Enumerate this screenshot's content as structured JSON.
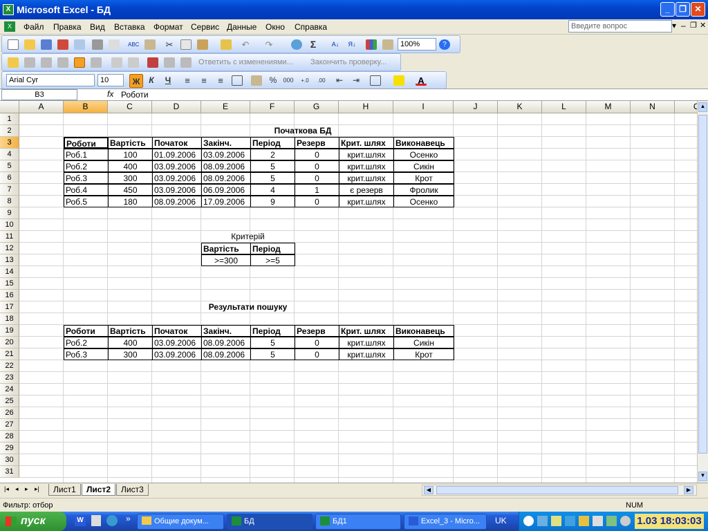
{
  "window": {
    "title": "Microsoft Excel - БД",
    "minimize": "_",
    "restore": "❐",
    "close": "✕"
  },
  "menu": {
    "items": [
      "Файл",
      "Правка",
      "Вид",
      "Вставка",
      "Формат",
      "Сервис",
      "Данные",
      "Окно",
      "Справка"
    ],
    "ask_placeholder": "Введите вопрос"
  },
  "toolbar": {
    "zoom": "100%",
    "review_reply": "Ответить с изменениями...",
    "review_end": "Закончить проверку...",
    "font_name": "Arial Cyr",
    "font_size": "10",
    "bold": "Ж",
    "italic": "К",
    "underline": "Ч",
    "percent": "%",
    "thousands": "000",
    "font_color_glyph": "A"
  },
  "formula_bar": {
    "name_box": "B3",
    "fx": "fx",
    "content": "Роботи"
  },
  "grid": {
    "columns": [
      "A",
      "B",
      "C",
      "D",
      "E",
      "F",
      "G",
      "H",
      "I",
      "J",
      "K",
      "L",
      "M",
      "N",
      "O"
    ],
    "rows": [
      "1",
      "2",
      "3",
      "4",
      "5",
      "6",
      "7",
      "8",
      "9",
      "10",
      "11",
      "12",
      "13",
      "14",
      "15",
      "16",
      "17",
      "18",
      "19",
      "20",
      "21",
      "22",
      "23",
      "24",
      "25",
      "26",
      "27",
      "28",
      "29",
      "30",
      "31"
    ],
    "db_title": "Початкова БД",
    "headers": [
      "Роботи",
      "Вартість",
      "Початок",
      "Закінч.",
      "Період",
      "Резерв",
      "Крит. шлях",
      "Виконавець"
    ],
    "db_rows": [
      [
        "Роб.1",
        "100",
        "01.09.2006",
        "03.09.2006",
        "2",
        "0",
        "крит.шлях",
        "Осенко"
      ],
      [
        "Роб.2",
        "400",
        "03.09.2006",
        "08.09.2006",
        "5",
        "0",
        "крит.шлях",
        "Сикін"
      ],
      [
        "Роб.3",
        "300",
        "03.09.2006",
        "08.09.2006",
        "5",
        "0",
        "крит.шлях",
        "Крот"
      ],
      [
        "Роб.4",
        "450",
        "03.09.2006",
        "06.09.2006",
        "4",
        "1",
        "є резерв",
        "Фролик"
      ],
      [
        "Роб.5",
        "180",
        "08.09.2006",
        "17.09.2006",
        "9",
        "0",
        "крит.шлях",
        "Осенко"
      ]
    ],
    "criteria_title": "Критерій",
    "criteria_headers": [
      "Вартість",
      "Період"
    ],
    "criteria_values": [
      ">=300",
      ">=5"
    ],
    "results_title": "Результати пошуку",
    "result_rows": [
      [
        "Роб.2",
        "400",
        "03.09.2006",
        "08.09.2006",
        "5",
        "0",
        "крит.шлях",
        "Сикін"
      ],
      [
        "Роб.3",
        "300",
        "03.09.2006",
        "08.09.2006",
        "5",
        "0",
        "крит.шлях",
        "Крот"
      ]
    ]
  },
  "sheets": {
    "tabs": [
      "Лист1",
      "Лист2",
      "Лист3"
    ],
    "active": "Лист2"
  },
  "status": {
    "text": "Фильтр: отбор",
    "num": "NUM"
  },
  "taskbar": {
    "start": "пуск",
    "tasks": [
      "Общие докум...",
      "БД",
      "БД1",
      "Excel_3 - Micro..."
    ],
    "lang": "UK",
    "clock": "1.03 18:03:03"
  }
}
